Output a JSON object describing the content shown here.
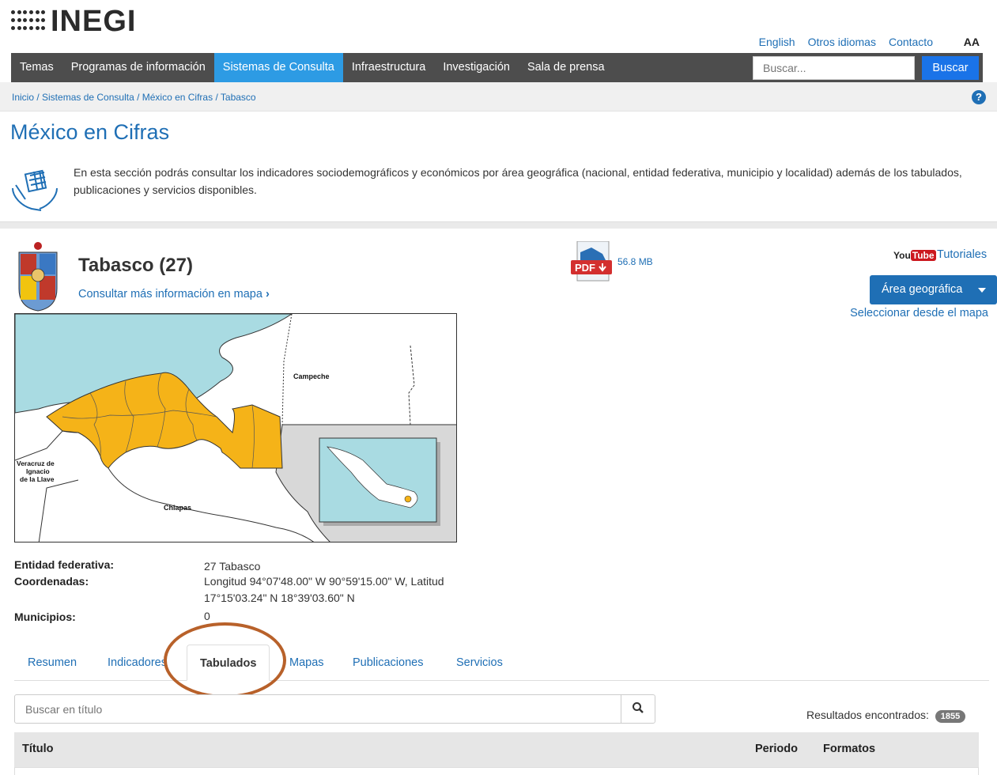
{
  "header": {
    "logo_text": "INEGI",
    "top_links": [
      "English",
      "Otros idiomas",
      "Contacto"
    ],
    "font_size_toggle": "AA"
  },
  "nav": {
    "items": [
      "Temas",
      "Programas de información",
      "Sistemas de Consulta",
      "Infraestructura",
      "Investigación",
      "Sala de prensa"
    ],
    "active": "Sistemas de Consulta",
    "search_placeholder": "Buscar...",
    "search_button": "Buscar"
  },
  "breadcrumb": "Inicio / Sistemas de Consulta / México en Cifras / Tabasco",
  "page": {
    "title": "México en Cifras",
    "intro": "En esta sección podrás consultar los indicadores sociodemográficos y económicos por área geográfica (nacional, entidad federativa, municipio y localidad) además de los tabulados, publicaciones y servicios disponibles."
  },
  "state": {
    "title": "Tabasco (27)",
    "map_link": "Consultar más información en mapa",
    "pdf_size": "56.8 MB",
    "youtube_label": "You",
    "youtube_tube": "Tube",
    "tutorials": "Tutoriales",
    "area_button": "Área geográfica",
    "select_map": "Seleccionar desde el mapa",
    "pdf_badge": "PDF",
    "map_labels": {
      "campeche": "Campeche",
      "veracruz": [
        "Veracruz de",
        "Ignacio",
        "de la Llave"
      ],
      "chiapas": "Chiapas"
    }
  },
  "info": {
    "labels": {
      "entidad": "Entidad federativa:",
      "coordenadas": "Coordenadas:",
      "municipios": "Municipios:"
    },
    "values": {
      "entidad": "27 Tabasco",
      "coord_line1": "Longitud 94°07'48.00\" W  90°59'15.00\" W, Latitud",
      "coord_line2": "17°15'03.24\" N  18°39'03.60\" N",
      "municipios": "0"
    }
  },
  "tabs": {
    "items": [
      "Resumen",
      "Indicadores",
      "Tabulados",
      "Mapas",
      "Publicaciones",
      "Servicios"
    ],
    "active": "Tabulados"
  },
  "results": {
    "search_placeholder": "Buscar en título",
    "label": "Resultados encontrados:",
    "count": "1855"
  },
  "table": {
    "columns": [
      "Título",
      "Periodo",
      "Formatos"
    ]
  },
  "colors": {
    "link": "#1f6fb5",
    "nav_bg": "#4d4d4d",
    "nav_active": "#2d9be4",
    "tabasco_fill": "#f5b318",
    "sea": "#a9dbe2",
    "highlight_ring": "#b8612a"
  }
}
